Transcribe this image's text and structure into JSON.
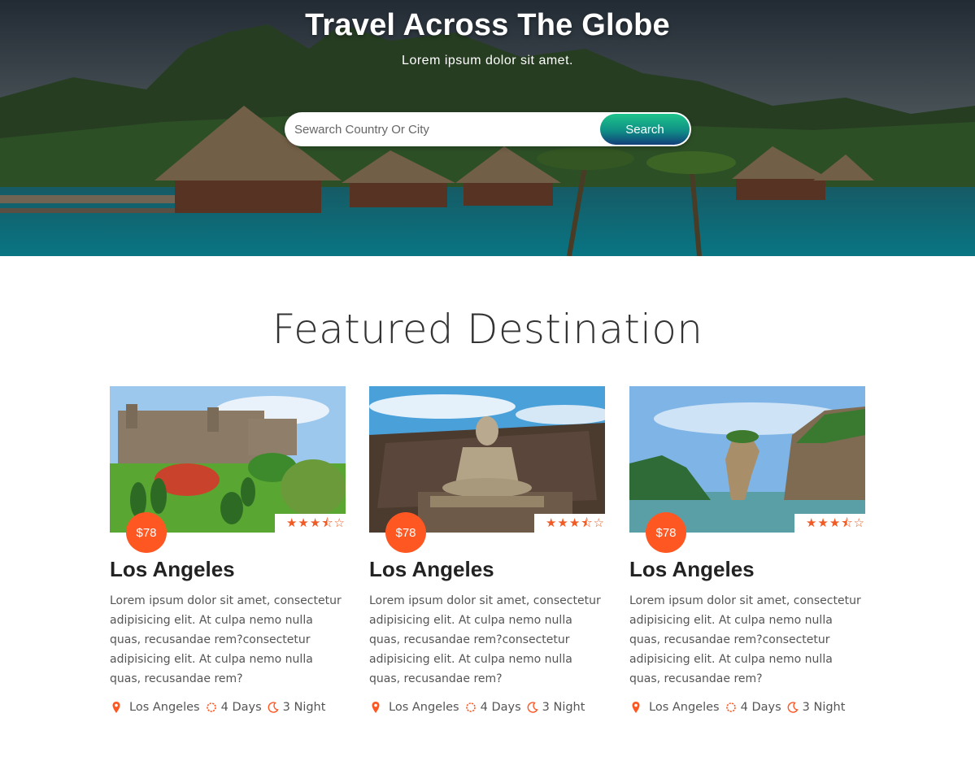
{
  "hero": {
    "title": "Travel Across The Globe",
    "subtitle": "Lorem ipsum dolor sit amet.",
    "search_placeholder": "Sewarch Country Or City",
    "search_button": "Search"
  },
  "section": {
    "title": "Featured Destination"
  },
  "colors": {
    "accent": "#ff5722",
    "star": "#f15a24",
    "button_top": "#1ec48a",
    "button_bottom": "#123f7a"
  },
  "cards": [
    {
      "price": "$78",
      "rating": 3.5,
      "rating_max": 5,
      "title": "Los Angeles",
      "description": "Lorem ipsum dolor sit amet, consectetur adipisicing elit. At culpa nemo nulla quas, recusandae rem?consectetur adipisicing elit. At culpa nemo nulla quas, recusandae rem?",
      "location": "Los Angeles",
      "days": "4 Days",
      "nights": "3 Night",
      "image": "castle-garden"
    },
    {
      "price": "$78",
      "rating": 3.5,
      "rating_max": 5,
      "title": "Los Angeles",
      "description": "Lorem ipsum dolor sit amet, consectetur adipisicing elit. At culpa nemo nulla quas, recusandae rem?consectetur adipisicing elit. At culpa nemo nulla quas, recusandae rem?",
      "location": "Los Angeles",
      "days": "4 Days",
      "nights": "3 Night",
      "image": "buddha-statue"
    },
    {
      "price": "$78",
      "rating": 3.5,
      "rating_max": 5,
      "title": "Los Angeles",
      "description": "Lorem ipsum dolor sit amet, consectetur adipisicing elit. At culpa nemo nulla quas, recusandae rem?consectetur adipisicing elit. At culpa nemo nulla quas, recusandae rem?",
      "location": "Los Angeles",
      "days": "4 Days",
      "nights": "3 Night",
      "image": "rock-island-bay"
    }
  ]
}
